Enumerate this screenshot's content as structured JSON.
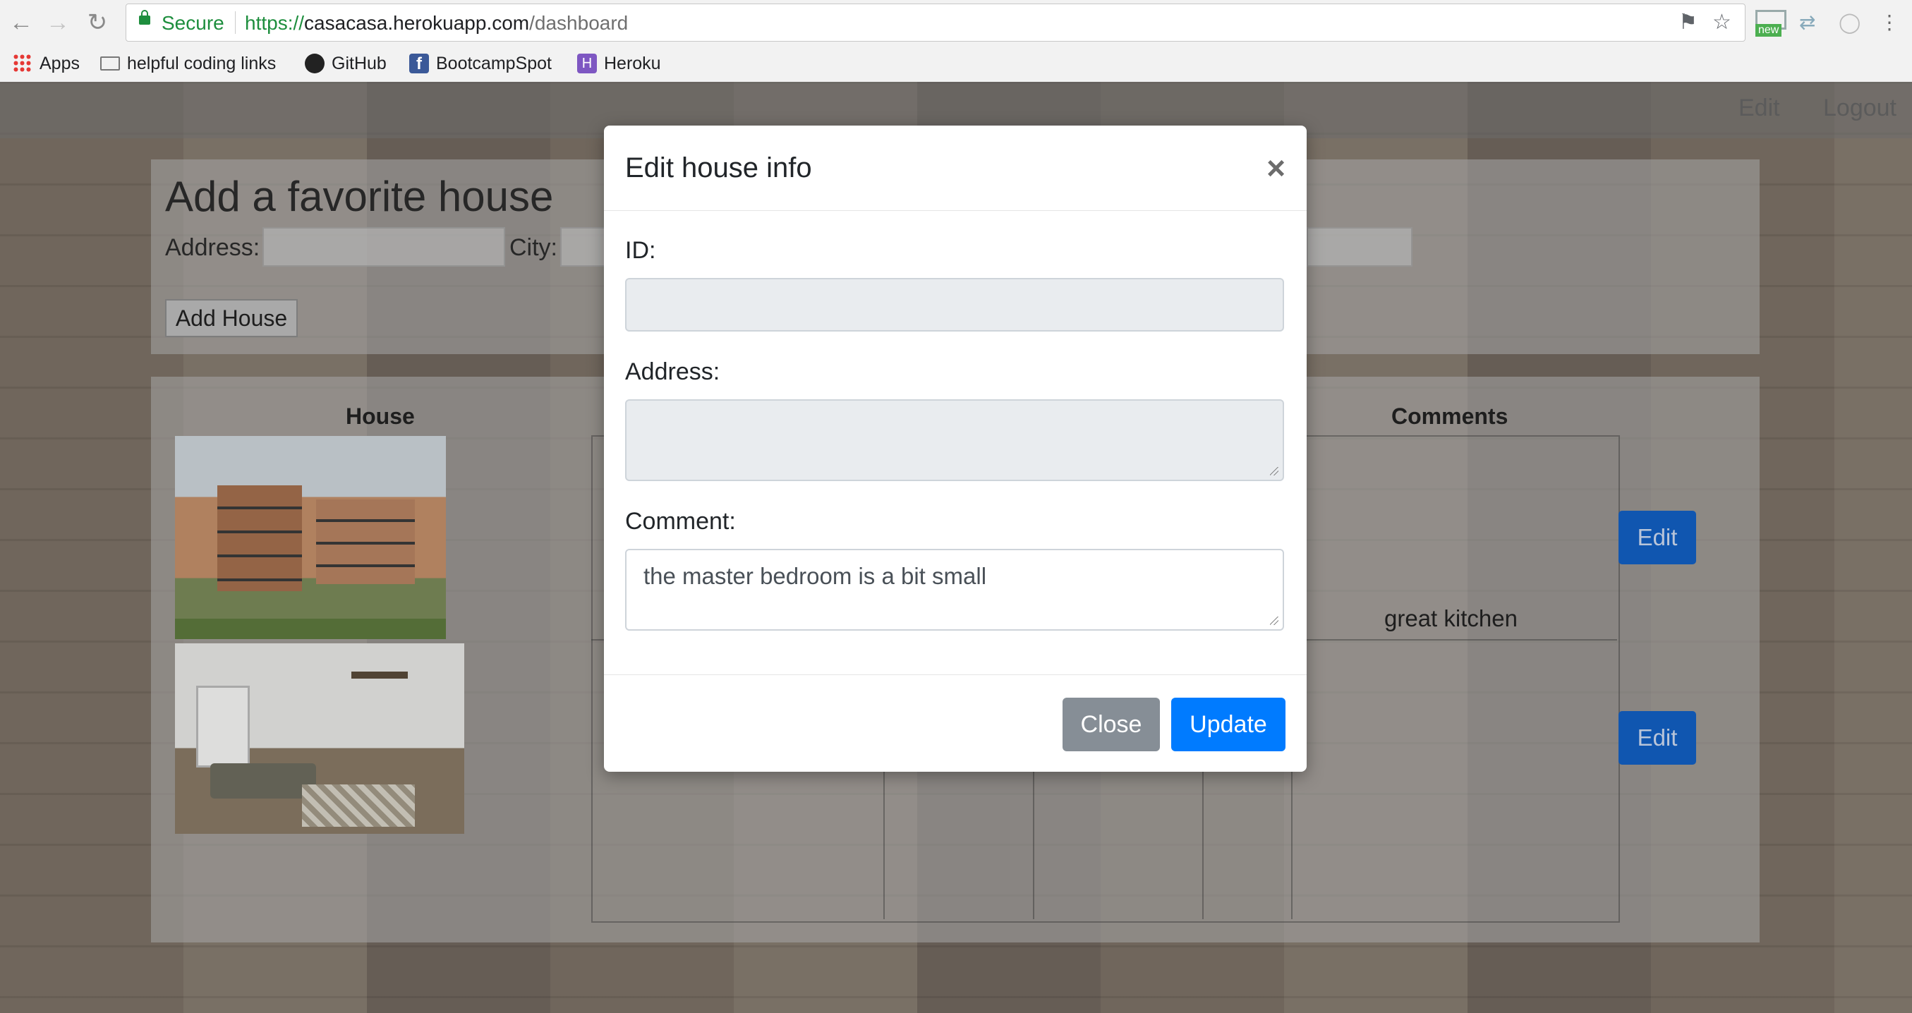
{
  "browser": {
    "secure_label": "Secure",
    "url_scheme": "https://",
    "url_host": "casacasa.herokuapp.com",
    "url_path": "/dashboard",
    "extension_badge": "new",
    "bookmarks": [
      {
        "label": "Apps",
        "icon": "apps-grid-icon"
      },
      {
        "label": "helpful coding links",
        "icon": "folder-icon"
      },
      {
        "label": "GitHub",
        "icon": "github-icon"
      },
      {
        "label": "BootcampSpot",
        "icon": "facebook-icon"
      },
      {
        "label": "Heroku",
        "icon": "heroku-icon"
      }
    ]
  },
  "page_nav": {
    "edit": "Edit",
    "logout": "Logout"
  },
  "add_form": {
    "title": "Add a favorite house",
    "address_label": "Address:",
    "city_label": "City:",
    "submit_label": "Add House"
  },
  "table": {
    "house_header": "House",
    "comments_header": "Comments",
    "rows": [
      {
        "comment": "great kitchen",
        "edit_label": "Edit"
      },
      {
        "comment": "",
        "edit_label": "Edit"
      }
    ]
  },
  "modal": {
    "title": "Edit house info",
    "close_symbol": "×",
    "id_label": "ID:",
    "id_value": "",
    "address_label": "Address:",
    "address_value": "",
    "comment_label": "Comment:",
    "comment_value": "the master bedroom is a bit small",
    "close_button": "Close",
    "update_button": "Update"
  },
  "colors": {
    "primary": "#007bff",
    "secondary": "#868e96",
    "secure_green": "#1e8e3e"
  }
}
